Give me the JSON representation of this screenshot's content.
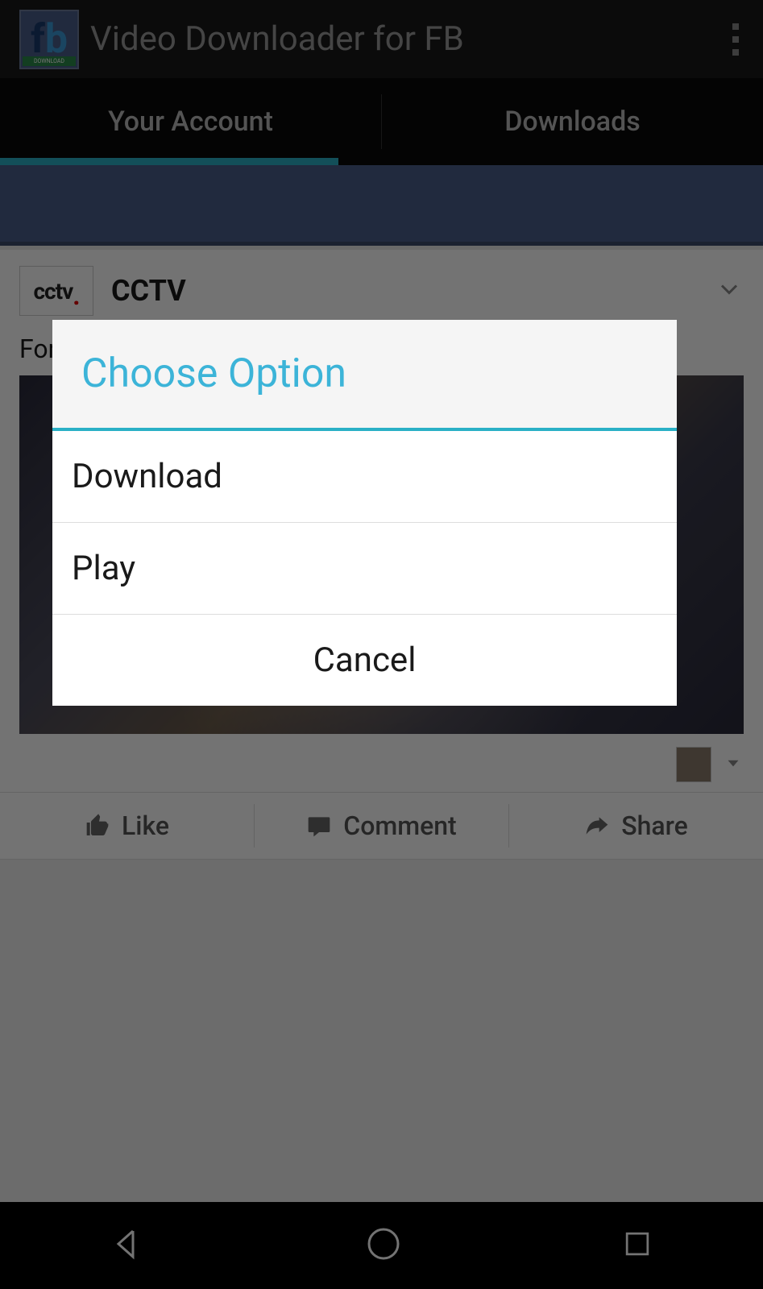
{
  "header": {
    "title": "Video Downloader for FB",
    "icon_label_bar": "DOWNLOAD"
  },
  "tabs": {
    "account": "Your Account",
    "downloads": "Downloads"
  },
  "post": {
    "source": "CCTV",
    "source_logo": "cctv",
    "text_prefix": "For",
    "actions": {
      "like": "Like",
      "comment": "Comment",
      "share": "Share"
    }
  },
  "dialog": {
    "title": "Choose Option",
    "option_download": "Download",
    "option_play": "Play",
    "cancel": "Cancel"
  }
}
